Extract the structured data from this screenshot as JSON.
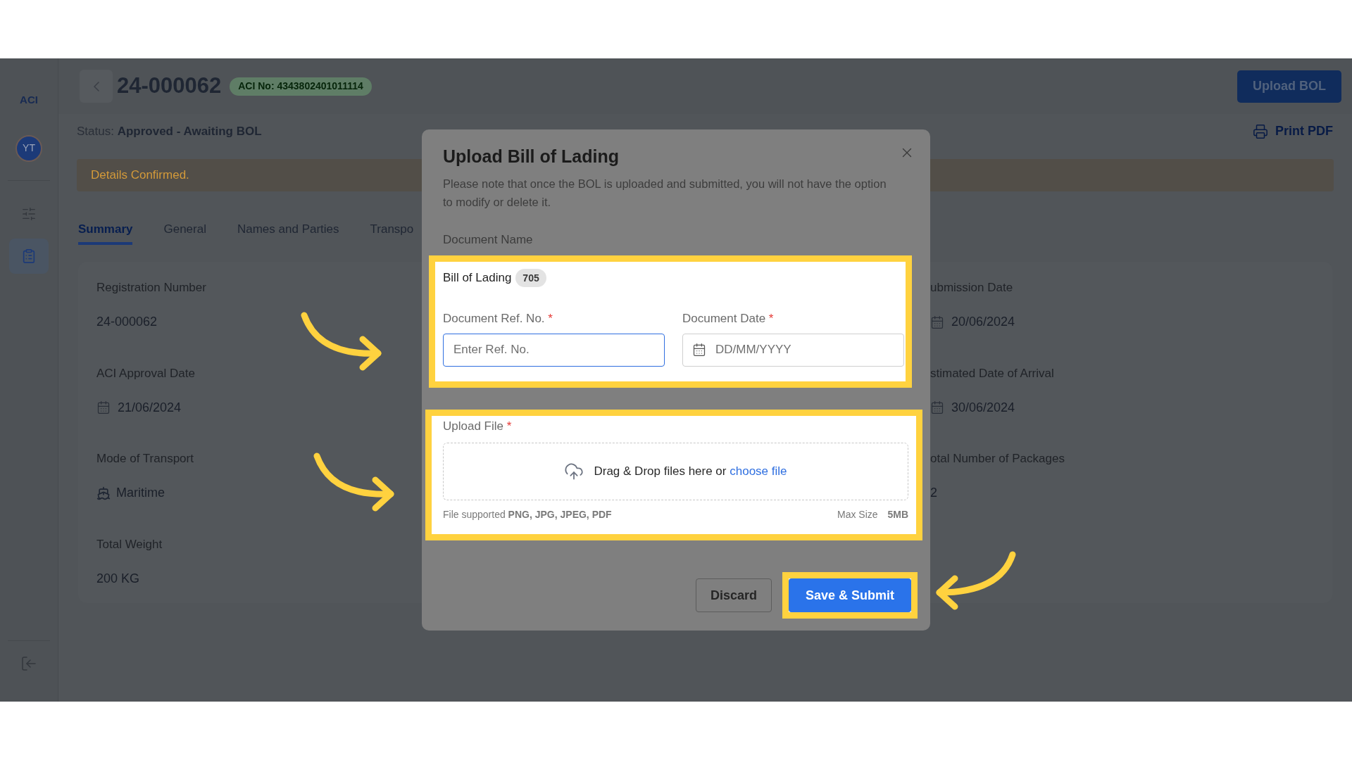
{
  "sidebar": {
    "logo": "ACI",
    "avatar": "YT",
    "nav_items": [
      {
        "selected": false
      },
      {
        "selected": true
      }
    ]
  },
  "header": {
    "title": "24-000062",
    "badge": "ACI No: 4343802401011114",
    "action": "Upload BOL"
  },
  "status": {
    "label": "Status:",
    "value": "Approved - Awaiting BOL",
    "print": "Print PDF"
  },
  "banner": "Details Confirmed.",
  "tabs": [
    {
      "label": "Summary",
      "selected": true
    },
    {
      "label": "General",
      "selected": false
    },
    {
      "label": "Names and Parties",
      "selected": false
    },
    {
      "label": "Transpo",
      "selected": false
    }
  ],
  "summary": {
    "left": [
      {
        "label": "Registration Number",
        "value": "24-000062",
        "kind": "text"
      },
      {
        "label": "ACI Approval Date",
        "value": "21/06/2024",
        "kind": "date"
      },
      {
        "label": "Mode of Transport",
        "value": "Maritime",
        "kind": "transport"
      },
      {
        "label": "Total Weight",
        "value": "200 KG",
        "kind": "text"
      }
    ],
    "right": [
      {
        "label": "ubmission Date",
        "value": "20/06/2024",
        "kind": "date"
      },
      {
        "label": "stimated Date of Arrival",
        "value": "30/06/2024",
        "kind": "date"
      },
      {
        "label": "otal Number of Packages",
        "value": "2",
        "kind": "text"
      }
    ]
  },
  "modal": {
    "title": "Upload Bill of Lading",
    "description": "Please note that once the BOL is uploaded and submitted, you will not have the option to modify or delete it.",
    "document_name_label": "Document Name",
    "document": {
      "name": "Bill of Lading",
      "code": "705"
    },
    "fields": [
      {
        "label": "Document Ref. No.",
        "required_mark": "*",
        "placeholder": "Enter Ref. No.",
        "kind": "text",
        "focused": true
      },
      {
        "label": "Document Date",
        "required_mark": "*",
        "placeholder": "DD/MM/YYYY",
        "kind": "date",
        "focused": false
      }
    ],
    "upload": {
      "label": "Upload File",
      "required_mark": "*",
      "prompt": "Drag & Drop files here or",
      "link": "choose file",
      "supported_label": "File supported",
      "supported_types": "PNG, JPG, JPEG, PDF",
      "max_label": "Max Size",
      "max_value": "5MB"
    },
    "buttons": [
      {
        "label": "Discard",
        "kind": "secondary"
      },
      {
        "label": "Save & Submit",
        "kind": "primary"
      }
    ]
  }
}
